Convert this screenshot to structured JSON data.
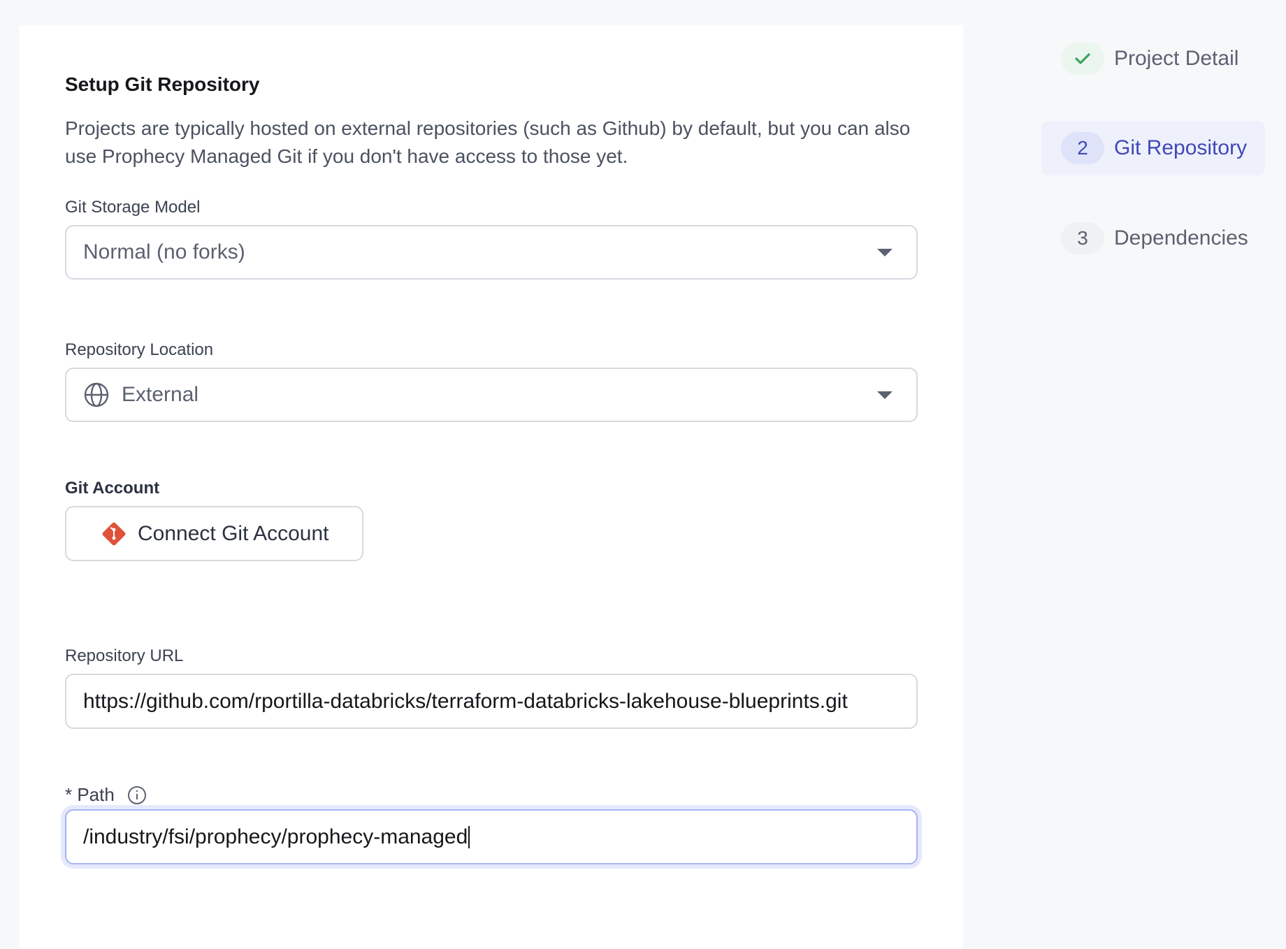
{
  "form": {
    "title": "Setup Git Repository",
    "description": "Projects are typically hosted on external repositories (such as Github) by default, but you can also use Prophecy Managed Git if you don't have access to those yet.",
    "storage_model": {
      "label": "Git Storage Model",
      "value": "Normal (no forks)"
    },
    "repo_location": {
      "label": "Repository Location",
      "value": "External",
      "icon": "globe-icon"
    },
    "git_account": {
      "label": "Git Account",
      "button_label": "Connect Git Account",
      "icon": "git-logo-icon"
    },
    "repo_url": {
      "label": "Repository URL",
      "value": "https://github.com/rportilla-databricks/terraform-databricks-lakehouse-blueprints.git"
    },
    "path": {
      "label": "* Path",
      "value": "/industry/fsi/prophecy/prophecy-managed"
    }
  },
  "stepper": {
    "steps": [
      {
        "badge": "",
        "label": "Project Detail",
        "state": "done"
      },
      {
        "badge": "2",
        "label": "Git Repository",
        "state": "current"
      },
      {
        "badge": "3",
        "label": "Dependencies",
        "state": "pending"
      }
    ]
  },
  "colors": {
    "accent": "#3f49b8",
    "success": "#3aa35f",
    "git_brand": "#e0513a"
  }
}
